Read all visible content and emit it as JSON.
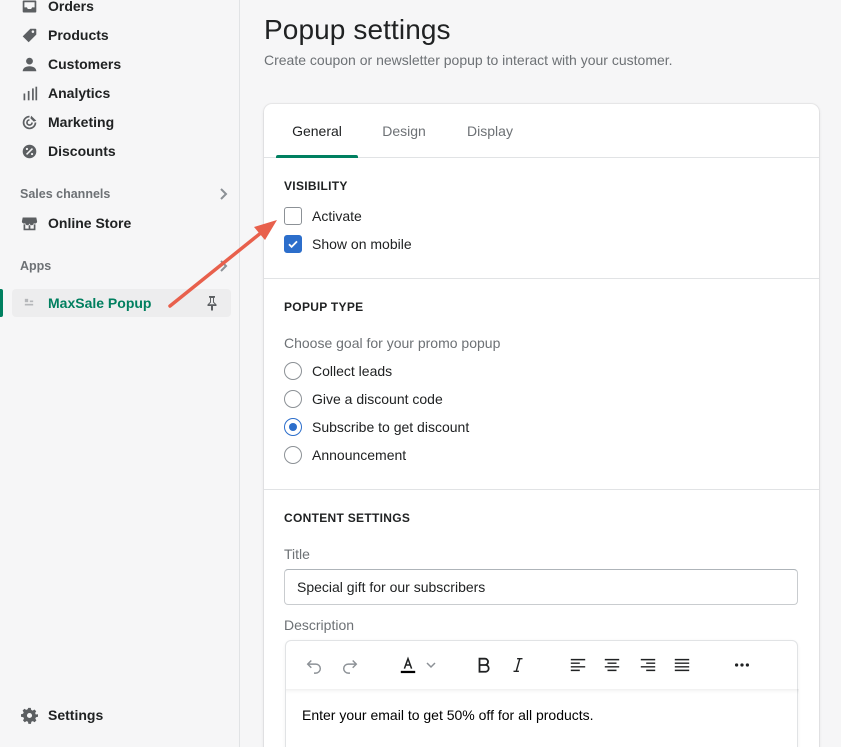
{
  "sidebar": {
    "items": [
      {
        "label": "Orders",
        "icon": "inbox-icon"
      },
      {
        "label": "Products",
        "icon": "tag-icon"
      },
      {
        "label": "Customers",
        "icon": "person-icon"
      },
      {
        "label": "Analytics",
        "icon": "bar-chart-icon"
      },
      {
        "label": "Marketing",
        "icon": "target-icon"
      },
      {
        "label": "Discounts",
        "icon": "discount-icon"
      }
    ],
    "sales_channels_label": "Sales channels",
    "online_store_label": "Online Store",
    "apps_label": "Apps",
    "app_item_label": "MaxSale Popup",
    "settings_label": "Settings"
  },
  "page": {
    "title": "Popup settings",
    "subtitle": "Create coupon or newsletter popup to interact with your customer."
  },
  "tabs": [
    {
      "label": "General",
      "active": true
    },
    {
      "label": "Design",
      "active": false
    },
    {
      "label": "Display",
      "active": false
    }
  ],
  "visibility": {
    "heading": "VISIBILITY",
    "activate_label": "Activate",
    "activate_checked": false,
    "mobile_label": "Show on mobile",
    "mobile_checked": true
  },
  "popup_type": {
    "heading": "POPUP TYPE",
    "hint": "Choose goal for your promo popup",
    "options": [
      {
        "label": "Collect leads",
        "selected": false
      },
      {
        "label": "Give a discount code",
        "selected": false
      },
      {
        "label": "Subscribe to get discount",
        "selected": true
      },
      {
        "label": "Announcement",
        "selected": false
      }
    ]
  },
  "content": {
    "heading": "CONTENT SETTINGS",
    "title_label": "Title",
    "title_value": "Special gift for our subscribers",
    "description_label": "Description",
    "description_value": "Enter your email to get 50% off for all products."
  },
  "colors": {
    "accent": "#008060",
    "primary_blue": "#2c6ecb",
    "annotation_arrow": "#e8604c"
  }
}
